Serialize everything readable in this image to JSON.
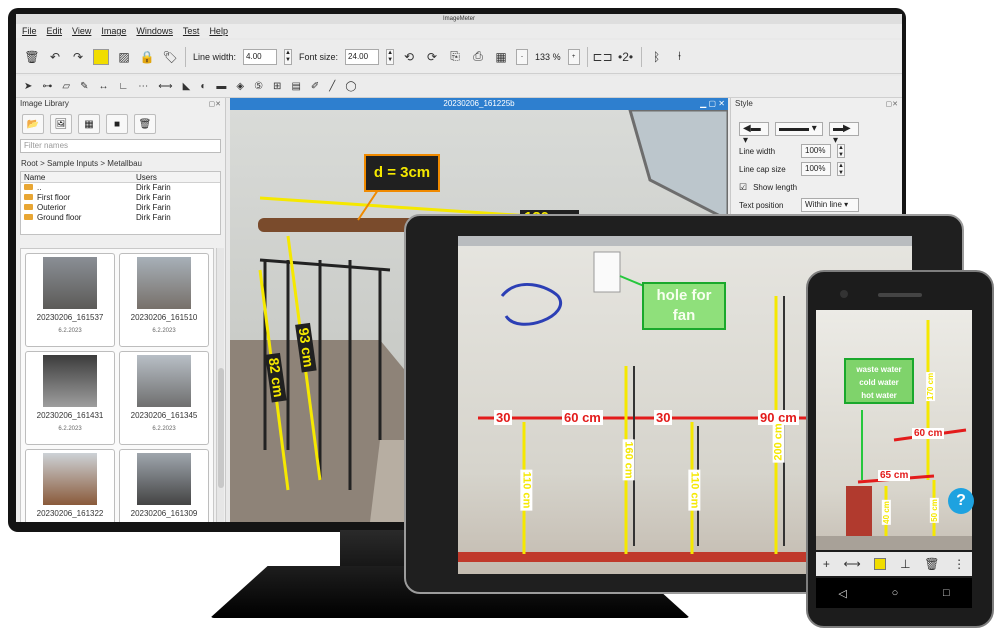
{
  "app": {
    "title": "ImageMeter",
    "menu": [
      "File",
      "Edit",
      "View",
      "Image",
      "Windows",
      "Test",
      "Help"
    ],
    "toolbar": {
      "line_width_label": "Line width:",
      "line_width_value": "4.00",
      "font_size_label": "Font size:",
      "font_size_value": "24.00",
      "zoom_value": "133 %",
      "zoom_plus": "+",
      "zoom_minus": "-",
      "accent_color": "#f1dd00"
    }
  },
  "library": {
    "title": "Image Library",
    "filter_placeholder": "Filter names",
    "breadcrumb": "Root > Sample Inputs > Metallbau",
    "columns": [
      "Name",
      "Users"
    ],
    "rows": [
      {
        "name": "..",
        "user": "Dirk Farin"
      },
      {
        "name": "First floor",
        "user": "Dirk Farin"
      },
      {
        "name": "Outerior",
        "user": "Dirk Farin"
      },
      {
        "name": "Ground floor",
        "user": "Dirk Farin"
      }
    ],
    "thumbnails": [
      {
        "name": "20230206_161537",
        "date": "6.2.2023"
      },
      {
        "name": "20230206_161510",
        "date": "6.2.2023"
      },
      {
        "name": "20230206_161431",
        "date": "6.2.2023"
      },
      {
        "name": "20230206_161345",
        "date": "6.2.2023"
      },
      {
        "name": "20230206_161322",
        "date": ""
      },
      {
        "name": "20230206_161309",
        "date": ""
      }
    ]
  },
  "image_window": {
    "title": "20230206_161225b",
    "labels": {
      "diameter": "d = 3cm",
      "top": "130 cm",
      "left_a": "93 cm",
      "left_b": "82 cm"
    }
  },
  "style_panel": {
    "title": "Style",
    "line_width_label": "Line width",
    "line_width_value": "100%",
    "line_cap_label": "Line cap size",
    "line_cap_value": "100%",
    "show_length_label": "Show length",
    "show_length_checked": true,
    "text_position_label": "Text position",
    "text_position_value": "Within line"
  },
  "tablet": {
    "labels": {
      "note": "hole for fan",
      "m30a": "30",
      "m60": "60 cm",
      "m30b": "30",
      "m90": "90 cm",
      "v110a": "110 cm",
      "v160": "160 cm",
      "v110b": "110 cm",
      "v200": "200 cm"
    }
  },
  "phone": {
    "labels": {
      "note_lines": [
        "waste water",
        "cold water",
        "hot water"
      ],
      "m60": "60 cm",
      "m65": "65 cm",
      "v170": "170 cm",
      "v40": "40 cm",
      "v50": "50 cm"
    },
    "help": "?"
  }
}
